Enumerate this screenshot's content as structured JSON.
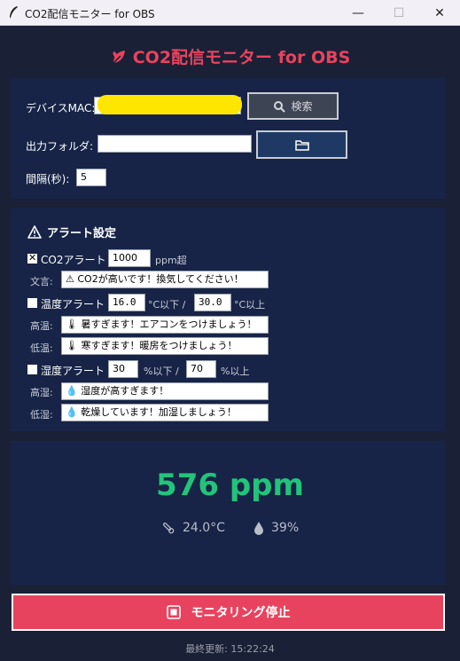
{
  "window": {
    "title": "CO2配信モニター for OBS",
    "min_glyph": "—",
    "max_glyph": "☐",
    "close_glyph": "✕"
  },
  "header": {
    "title": "CO2配信モニター for OBS",
    "icon": "leaf-icon"
  },
  "device": {
    "mac_label": "デバイスMAC:",
    "mac_value": "",
    "search_label": "検索",
    "folder_label": "出力フォルダ:",
    "folder_value": "",
    "interval_label": "間隔(秒):",
    "interval_value": "5"
  },
  "alerts": {
    "section_title": "アラート設定",
    "co2": {
      "enabled": true,
      "label": "CO2アラート",
      "threshold": "1000",
      "unit": "ppm超",
      "message_label": "文言:",
      "message": "⚠ CO2が高いです！換気してください！"
    },
    "temp": {
      "enabled": false,
      "label": "温度アラート",
      "low": "16.0",
      "low_unit": "°C以下 /",
      "high": "30.0",
      "high_unit": "°C以上",
      "high_label": "高温:",
      "high_message": "🌡 暑すぎます！エアコンをつけましょう！",
      "low_label": "低温:",
      "low_message": "🌡 寒すぎます！暖房をつけましょう！"
    },
    "humidity": {
      "enabled": false,
      "label": "湿度アラート",
      "low": "30",
      "low_unit": "%以下 /",
      "high": "70",
      "high_unit": "%以上",
      "high_label": "高湿:",
      "high_message": "💧 湿度が高すぎます！",
      "low_label": "低湿:",
      "low_message": "💧 乾燥しています！加湿しましょう！"
    }
  },
  "reading": {
    "co2": "576 ppm",
    "temperature": "24.0°C",
    "humidity": "39%",
    "co2_color": "#22c47a"
  },
  "footer": {
    "stop_label": "モニタリング停止",
    "last_update": "最終更新: 15:22:24"
  },
  "colors": {
    "accent": "#e8435e",
    "background": "#1a2035",
    "panel": "#172447"
  }
}
